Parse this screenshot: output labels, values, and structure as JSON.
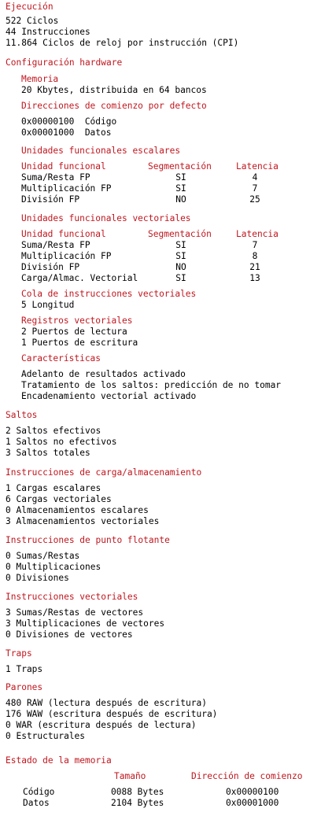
{
  "colors": {
    "heading": "#c0171f",
    "text": "#000000",
    "background": "#ffffff"
  },
  "ejecucion": {
    "title": "Ejecución",
    "lines": [
      "522 Ciclos",
      "44 Instrucciones",
      "11.864 Ciclos de reloj por instrucción (CPI)"
    ]
  },
  "config": {
    "title": "Configuración hardware",
    "memoria": {
      "title": "Memoria",
      "line": "20 Kbytes, distribuida en 64 bancos"
    },
    "direcciones": {
      "title": "Direcciones de comienzo por defecto",
      "lines": [
        "0x00000100  Código",
        "0x00001000  Datos"
      ]
    },
    "escalares": {
      "title": "Unidades funcionales escalares",
      "headers": {
        "unidad": "Unidad funcional",
        "segmentacion": "Segmentación",
        "latencia": "Latencia"
      },
      "rows": [
        {
          "unidad": "Suma/Resta FP",
          "seg": "SI",
          "lat": "4"
        },
        {
          "unidad": "Multiplicación FP",
          "seg": "SI",
          "lat": "7"
        },
        {
          "unidad": "División FP",
          "seg": "NO",
          "lat": "25"
        }
      ]
    },
    "vectoriales": {
      "title": "Unidades funcionales vectoriales",
      "headers": {
        "unidad": "Unidad funcional",
        "segmentacion": "Segmentación",
        "latencia": "Latencia"
      },
      "rows": [
        {
          "unidad": "Suma/Resta FP",
          "seg": "SI",
          "lat": "7"
        },
        {
          "unidad": "Multiplicación FP",
          "seg": "SI",
          "lat": "8"
        },
        {
          "unidad": "División FP",
          "seg": "NO",
          "lat": "21"
        },
        {
          "unidad": "Carga/Almac. Vectorial",
          "seg": "SI",
          "lat": "13"
        }
      ]
    },
    "cola": {
      "title": "Cola de instrucciones vectoriales",
      "line": "5 Longitud"
    },
    "registros": {
      "title": "Registros vectoriales",
      "lines": [
        "2 Puertos de lectura",
        "1 Puertos de escritura"
      ]
    },
    "caracteristicas": {
      "title": "Características",
      "lines": [
        "Adelanto de resultados activado",
        "Tratamiento de los saltos: predicción de no tomar",
        "Encadenamiento vectorial activado"
      ]
    }
  },
  "saltos": {
    "title": "Saltos",
    "lines": [
      "2 Saltos efectivos",
      "1 Saltos no efectivos",
      "3 Saltos totales"
    ]
  },
  "carga": {
    "title": "Instrucciones de carga/almacenamiento",
    "lines": [
      "1 Cargas escalares",
      "6 Cargas vectoriales",
      "0 Almacenamientos escalares",
      "3 Almacenamientos vectoriales"
    ]
  },
  "flotante": {
    "title": "Instrucciones de punto flotante",
    "lines": [
      "0 Sumas/Restas",
      "0 Multiplicaciones",
      "0 Divisiones"
    ]
  },
  "vectoriales_instr": {
    "title": "Instrucciones vectoriales",
    "lines": [
      "3 Sumas/Restas de vectores",
      "3 Multiplicaciones de vectores",
      "0 Divisiones de vectores"
    ]
  },
  "traps": {
    "title": "Traps",
    "lines": [
      "1 Traps"
    ]
  },
  "parones": {
    "title": "Parones",
    "lines": [
      "480 RAW (lectura después de escritura)",
      "176 WAW (escritura después de escritura)",
      "0 WAR (escritura después de lectura)",
      "0 Estructurales"
    ]
  },
  "memoria_estado": {
    "title": "Estado de la memoria",
    "headers": {
      "tamano": "Tamaño",
      "direccion": "Dirección de comienzo"
    },
    "rows": [
      {
        "nombre": "Código",
        "tamano": "0088 Bytes",
        "direccion": "0x00000100"
      },
      {
        "nombre": "Datos",
        "tamano": "2104 Bytes",
        "direccion": "0x00001000"
      }
    ]
  }
}
